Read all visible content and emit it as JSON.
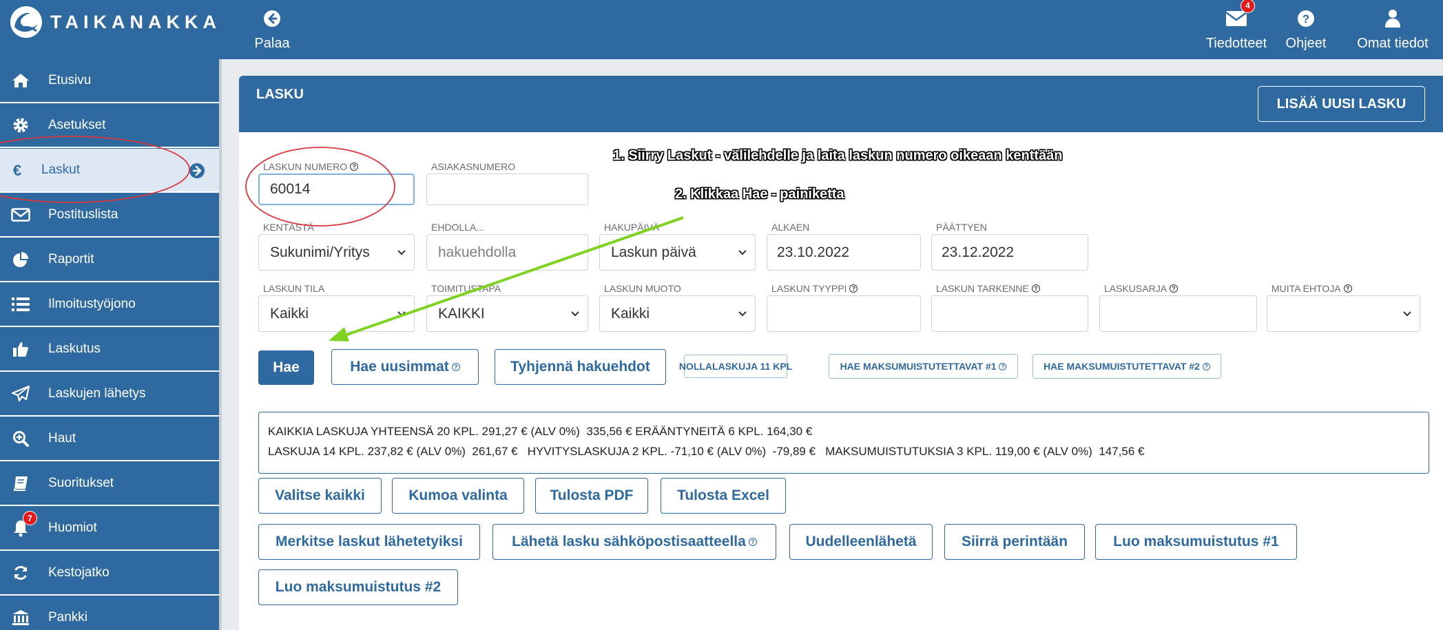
{
  "brand": {
    "logo_text": "TAIKANAKKA"
  },
  "topnav": {
    "back_label": "Palaa",
    "notices_label": "Tiedotteet",
    "notices_badge": "4",
    "help_label": "Ohjeet",
    "profile_label": "Omat tiedot"
  },
  "sidebar": {
    "items": [
      {
        "label": "Etusivu",
        "icon": "home-icon"
      },
      {
        "label": "Asetukset",
        "icon": "gear-icon"
      },
      {
        "label": "Laskut",
        "icon": "euro-icon",
        "active": true
      },
      {
        "label": "Postituslista",
        "icon": "envelope-icon"
      },
      {
        "label": "Raportit",
        "icon": "pie-chart-icon"
      },
      {
        "label": "Ilmoitustyöjono",
        "icon": "list-icon"
      },
      {
        "label": "Laskutus",
        "icon": "thumbs-up-icon"
      },
      {
        "label": "Laskujen lähetys",
        "icon": "paper-plane-icon"
      },
      {
        "label": "Haut",
        "icon": "search-plus-icon"
      },
      {
        "label": "Suoritukset",
        "icon": "book-icon"
      },
      {
        "label": "Huomiot",
        "icon": "bell-icon",
        "badge": "7"
      },
      {
        "label": "Kestojatko",
        "icon": "refresh-icon"
      },
      {
        "label": "Pankki",
        "icon": "bank-icon"
      }
    ]
  },
  "panel": {
    "title": "LASKU",
    "add_button": "LISÄÄ UUSI LASKU"
  },
  "fields": {
    "invoice_number": {
      "label": "LASKUN NUMERO",
      "value": "60014"
    },
    "customer_number": {
      "label": "ASIAKASNUMERO",
      "value": ""
    },
    "field_from": {
      "label": "KENTÄSTÄ",
      "value": "Sukunimi/Yritys"
    },
    "condition": {
      "label": "EHDOLLA...",
      "placeholder": "hakuehdolla"
    },
    "search_date": {
      "label": "HAKUPÄIVÄ",
      "value": "Laskun päivä"
    },
    "start": {
      "label": "ALKAEN",
      "value": "23.10.2022"
    },
    "end": {
      "label": "PÄÄTTYEN",
      "value": "23.12.2022"
    },
    "status": {
      "label": "LASKUN TILA",
      "value": "Kaikki"
    },
    "delivery": {
      "label": "TOIMITUSTAPA",
      "value": "KAIKKI"
    },
    "form": {
      "label": "LASKUN MUOTO",
      "value": "Kaikki"
    },
    "type": {
      "label": "LASKUN TYYPPI",
      "value": ""
    },
    "specifier": {
      "label": "LASKUN TARKENNE",
      "value": ""
    },
    "series": {
      "label": "LASKUSARJA",
      "value": ""
    },
    "other": {
      "label": "MUITA EHTOJA",
      "value": ""
    }
  },
  "search_buttons": {
    "search": "Hae",
    "latest": "Hae uusimmat",
    "clear": "Tyhjennä hakuehdot",
    "zero_invoices": "NOLLALASKUJA 11 KPL",
    "reminders_1": "HAE MAKSUMUISTUTETTAVAT #1",
    "reminders_2": "HAE MAKSUMUISTUTETTAVAT #2"
  },
  "summary": {
    "line1": "KAIKKIA LASKUJA YHTEENSÄ 20 KPL. 291,27 € (ALV 0%)  335,56 € ERÄÄNTYNEITÄ 6 KPL. 164,30 €",
    "line2": "LASKUJA 14 KPL. 237,82 € (ALV 0%)  261,67 €   HYVITYSLASKUJA 2 KPL. -71,10 € (ALV 0%)  -79,89 €   MAKSUMUISTUTUKSIA 3 KPL. 119,00 € (ALV 0%)  147,56 €"
  },
  "actions": {
    "select_all": "Valitse kaikki",
    "deselect": "Kumoa valinta",
    "print_pdf": "Tulosta PDF",
    "print_excel": "Tulosta Excel",
    "mark_sent": "Merkitse laskut lähetetyiksi",
    "send_email": "Lähetä lasku sähköpostisaatteella",
    "resend": "Uudelleenlähetä",
    "to_collection": "Siirrä perintään",
    "reminder_1": "Luo maksumuistutus #1",
    "reminder_2": "Luo maksumuistutus #2"
  },
  "annotations": {
    "step1": "1. Siirry Laskut - välilehdelle ja laita laskun numero oikeaan kenttään",
    "step2": "2. Klikkaa Hae - painiketta"
  },
  "colors": {
    "brand_blue": "#2e6a9f",
    "annotation_red": "#d9363e",
    "arrow_green": "#7ed321"
  }
}
